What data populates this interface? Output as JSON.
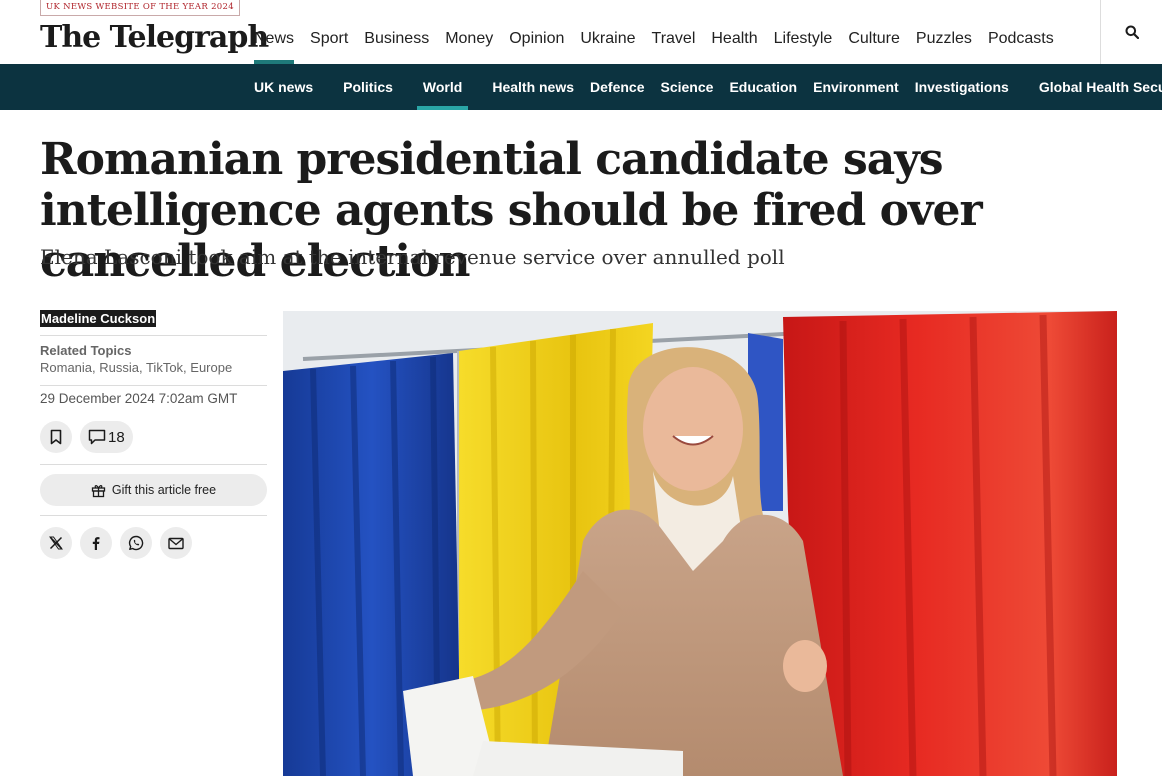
{
  "header": {
    "award": "UK NEWS WEBSITE OF THE YEAR 2024",
    "logo": "The Telegraph",
    "nav": [
      "News",
      "Sport",
      "Business",
      "Money",
      "Opinion",
      "Ukraine",
      "Travel",
      "Health",
      "Lifestyle",
      "Culture",
      "Puzzles",
      "Podcasts"
    ],
    "active_nav": "News",
    "search_icon": "search-icon"
  },
  "subnav": {
    "items": [
      "UK news",
      "Politics",
      "World",
      "Health news",
      "Defence",
      "Science",
      "Education",
      "Environment",
      "Investigations",
      "Global Health Security"
    ],
    "active": "World"
  },
  "article": {
    "headline": "Romanian presidential candidate says intelligence agents should be fired over cancelled election",
    "standfirst": "Elena Lasconi took aim at the internal revenue service over annulled poll",
    "author": "Madeline Cuckson",
    "related_label": "Related Topics",
    "related_topics": "Romania, Russia, TikTok, Europe",
    "date": "29 December 2024 7:02am GMT",
    "comment_count": "18",
    "gift_label": "Gift this article free",
    "share_icons": [
      "x-icon",
      "facebook-icon",
      "whatsapp-icon",
      "email-icon"
    ]
  },
  "colors": {
    "subnav_bg": "#0c3340",
    "accent": "#1f7a7a",
    "award_red": "#b0242b",
    "flag_blue": "#1f45a8",
    "flag_yellow": "#f2d21b",
    "flag_red": "#d9201c"
  }
}
